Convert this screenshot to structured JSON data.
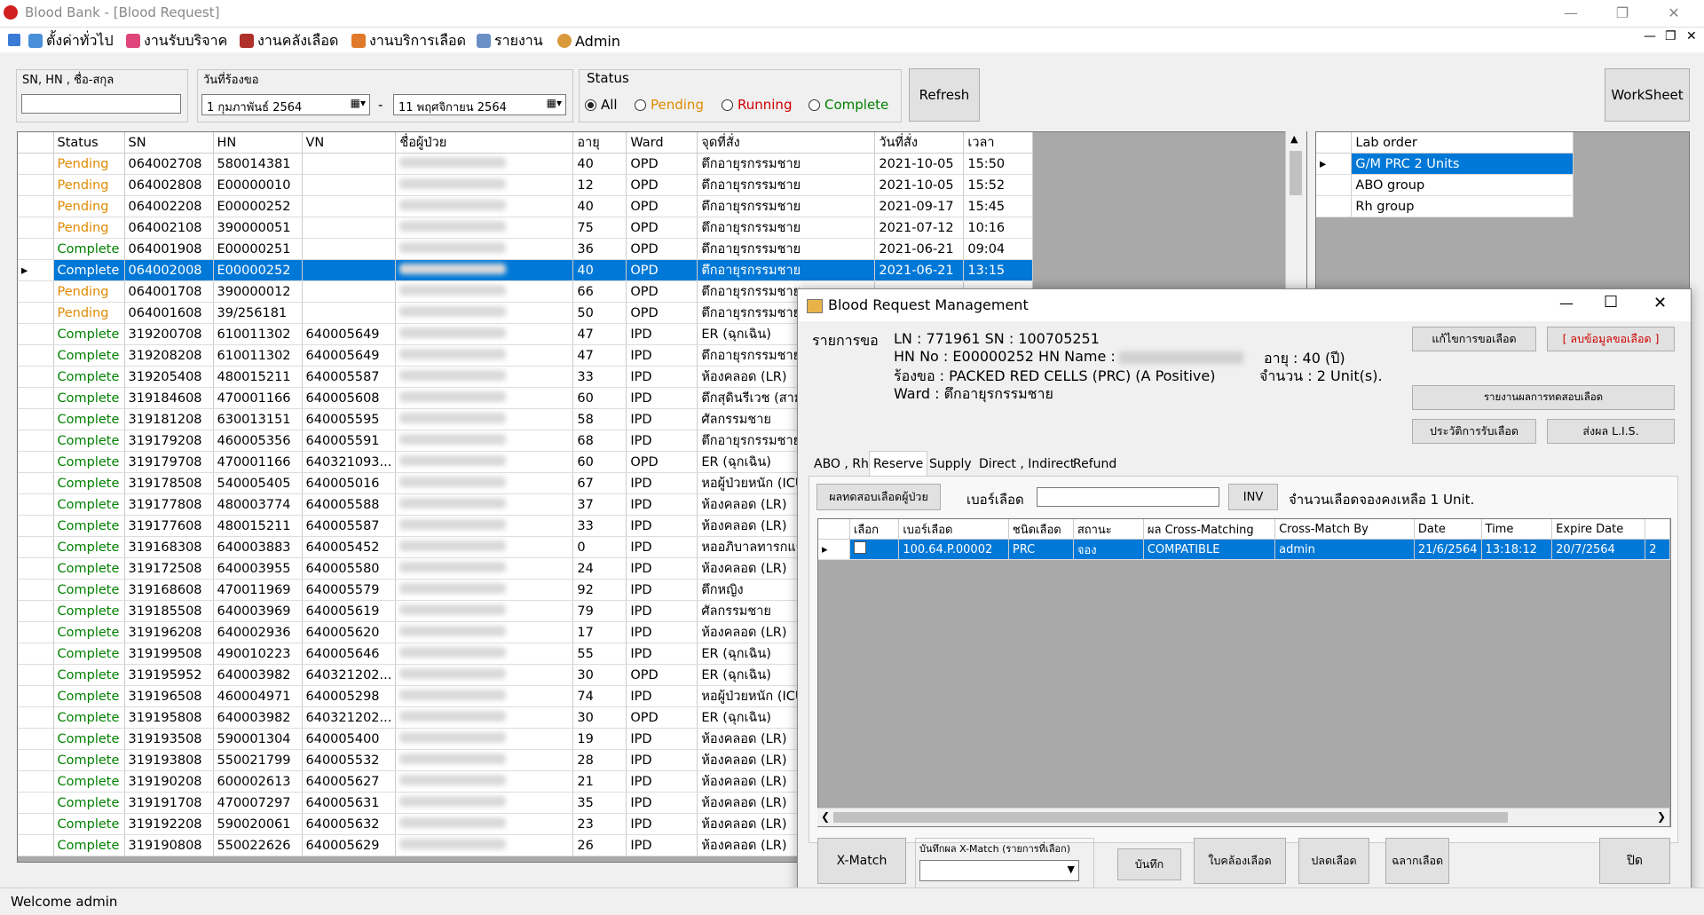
{
  "window": {
    "title": "Blood Bank - [Blood Request]"
  },
  "menu": [
    {
      "label": "ตั้งค่าทั่วไป",
      "icon": "settings-icon"
    },
    {
      "label": "งานรับบริจาค",
      "icon": "donate-icon"
    },
    {
      "label": "งานคลังเลือด",
      "icon": "blood-storage-icon"
    },
    {
      "label": "งานบริการเลือด",
      "icon": "blood-service-icon"
    },
    {
      "label": "รายงาน",
      "icon": "report-icon"
    },
    {
      "label": "Admin",
      "icon": "admin-icon"
    }
  ],
  "filters": {
    "search_label": "SN, HN , ชื่อ-สกุล",
    "search_value": "",
    "date_label": "วันที่ร้องขอ",
    "date_from": "1 กุมภาพันธ์   2564",
    "date_to": "11 พฤศจิกายน   2564",
    "date_sep": "-",
    "status_label": "Status",
    "status_options": [
      "All",
      "Pending",
      "Running",
      "Complete"
    ],
    "refresh": "Refresh",
    "worksheet": "WorkSheet",
    "colors": {
      "pending": "#e08a00",
      "running": "#d00000",
      "complete": "#008000"
    }
  },
  "grid": {
    "columns": [
      "Status",
      "SN",
      "HN",
      "VN",
      "ชื่อผู้ป่วย",
      "อายุ",
      "Ward",
      "จุดที่สั่ง",
      "วันที่สั่ง",
      "เวลา"
    ],
    "rows": [
      [
        "Pending",
        "064002708",
        "580014381",
        "",
        "",
        "40",
        "OPD",
        "ตึกอายุรกรรมชาย",
        "2021-10-05",
        "15:50"
      ],
      [
        "Pending",
        "064002808",
        "E00000010",
        "",
        "",
        "12",
        "OPD",
        "ตึกอายุรกรรมชาย",
        "2021-10-05",
        "15:52"
      ],
      [
        "Pending",
        "064002208",
        "E00000252",
        "",
        "",
        "40",
        "OPD",
        "ตึกอายุรกรรมชาย",
        "2021-09-17",
        "15:45"
      ],
      [
        "Pending",
        "064002108",
        "390000051",
        "",
        "",
        "75",
        "OPD",
        "ตึกอายุรกรรมชาย",
        "2021-07-12",
        "10:16"
      ],
      [
        "Complete",
        "064001908",
        "E00000251",
        "",
        "",
        "36",
        "OPD",
        "ตึกอายุรกรรมชาย",
        "2021-06-21",
        "09:04"
      ],
      [
        "Complete",
        "064002008",
        "E00000252",
        "",
        "",
        "40",
        "OPD",
        "ตึกอายุรกรรมชาย",
        "2021-06-21",
        "13:15"
      ],
      [
        "Pending",
        "064001708",
        "390000012",
        "",
        "",
        "66",
        "OPD",
        "ตึกอายุรกรรมชาย",
        "",
        ""
      ],
      [
        "Pending",
        "064001608",
        "39/256181",
        "",
        "",
        "50",
        "OPD",
        "ตึกอายุรกรรมชาย",
        "",
        ""
      ],
      [
        "Complete",
        "319200708",
        "610011302",
        "640005649",
        "",
        "47",
        "IPD",
        "ER (ฉุกเฉิน)",
        "",
        ""
      ],
      [
        "Complete",
        "319208208",
        "610011302",
        "640005649",
        "",
        "47",
        "IPD",
        "ตึกอายุรกรรมชาย",
        "",
        ""
      ],
      [
        "Complete",
        "319205408",
        "480015211",
        "640005587",
        "",
        "33",
        "IPD",
        "ห้องคลอด (LR)",
        "",
        ""
      ],
      [
        "Complete",
        "319184608",
        "470001166",
        "640005608",
        "",
        "60",
        "IPD",
        "ตึกสุดินรีเวช (สามัญ)",
        "",
        ""
      ],
      [
        "Complete",
        "319181208",
        "630013151",
        "640005595",
        "",
        "58",
        "IPD",
        "ศัลกรรมชาย",
        "",
        ""
      ],
      [
        "Complete",
        "319179208",
        "460005356",
        "640005591",
        "",
        "68",
        "IPD",
        "ตึกอายุรกรรมชาย",
        "",
        ""
      ],
      [
        "Complete",
        "319179708",
        "470001166",
        "640321093...",
        "",
        "60",
        "OPD",
        "ER (ฉุกเฉิน)",
        "",
        ""
      ],
      [
        "Complete",
        "319178508",
        "540005405",
        "640005016",
        "",
        "67",
        "IPD",
        "หอผู้ป่วยหนัก (ICU)",
        "",
        ""
      ],
      [
        "Complete",
        "319177808",
        "480003774",
        "640005588",
        "",
        "37",
        "IPD",
        "ห้องคลอด (LR)",
        "",
        ""
      ],
      [
        "Complete",
        "319177608",
        "480015211",
        "640005587",
        "",
        "33",
        "IPD",
        "ห้องคลอด (LR)",
        "",
        ""
      ],
      [
        "Complete",
        "319168308",
        "640003883",
        "640005452",
        "",
        "0",
        "IPD",
        "หออภิบาลทารกแรกเกิด",
        "",
        ""
      ],
      [
        "Complete",
        "319172508",
        "640003955",
        "640005580",
        "",
        "24",
        "IPD",
        "ห้องคลอด (LR)",
        "",
        ""
      ],
      [
        "Complete",
        "319168608",
        "470011969",
        "640005579",
        "",
        "92",
        "IPD",
        "ตึกหญิง",
        "",
        ""
      ],
      [
        "Complete",
        "319185508",
        "640003969",
        "640005619",
        "",
        "79",
        "IPD",
        "ศัลกรรมชาย",
        "",
        ""
      ],
      [
        "Complete",
        "319196208",
        "640002936",
        "640005620",
        "",
        "17",
        "IPD",
        "ห้องคลอด (LR)",
        "",
        ""
      ],
      [
        "Complete",
        "319199508",
        "490010223",
        "640005646",
        "",
        "55",
        "IPD",
        "ER (ฉุกเฉิน)",
        "",
        ""
      ],
      [
        "Complete",
        "319195952",
        "640003982",
        "640321202...",
        "",
        "30",
        "OPD",
        "ER (ฉุกเฉิน)",
        "",
        ""
      ],
      [
        "Complete",
        "319196508",
        "460004971",
        "640005298",
        "",
        "74",
        "IPD",
        "หอผู้ป่วยหนัก (ICU)",
        "",
        ""
      ],
      [
        "Complete",
        "319195808",
        "640003982",
        "640321202...",
        "",
        "30",
        "OPD",
        "ER (ฉุกเฉิน)",
        "",
        ""
      ],
      [
        "Complete",
        "319193508",
        "590001304",
        "640005400",
        "",
        "19",
        "IPD",
        "ห้องคลอด (LR)",
        "",
        ""
      ],
      [
        "Complete",
        "319193808",
        "550021799",
        "640005532",
        "",
        "28",
        "IPD",
        "ห้องคลอด (LR)",
        "",
        ""
      ],
      [
        "Complete",
        "319190208",
        "600002613",
        "640005627",
        "",
        "21",
        "IPD",
        "ห้องคลอด (LR)",
        "",
        ""
      ],
      [
        "Complete",
        "319191708",
        "470007297",
        "640005631",
        "",
        "35",
        "IPD",
        "ห้องคลอด (LR)",
        "",
        ""
      ],
      [
        "Complete",
        "319192208",
        "590020061",
        "640005632",
        "",
        "23",
        "IPD",
        "ห้องคลอด (LR)",
        "",
        ""
      ],
      [
        "Complete",
        "319190808",
        "550022626",
        "640005629",
        "",
        "26",
        "IPD",
        "ห้องคลอด (LR)",
        "",
        ""
      ]
    ]
  },
  "lab_order": {
    "header": "Lab order",
    "items": [
      "G/M PRC 2 Units",
      "ABO group",
      "Rh group"
    ]
  },
  "dialog": {
    "title": "Blood Request Management",
    "info_label": "รายการขอ",
    "line1": "LN : 771961    SN : 100705251",
    "hn": "HN No : E00000252    HN Name :",
    "age": "อายุ : 40 (ปี)",
    "request": "ร้องขอ : PACKED RED CELLS (PRC)     (A Positive)",
    "amount": "จำนวน : 2 Unit(s).",
    "ward": "Ward : ตึกอายุรกรรมชาย",
    "btn_edit": "แก้ไขการขอเลือด",
    "btn_delete": "[ ลบข้อมูลขอเลือด ]",
    "btn_report": "รายงานผลการทดสอบเลือด",
    "btn_history": "ประวัติการรับเลือด",
    "btn_lis": "ส่งผล L.I.S.",
    "tabs": [
      "ABO , Rh",
      "Reserve",
      "Supply",
      "Direct , Indirect",
      "Refund"
    ],
    "btn_patient_test": "ผลทดสอบเลือดผู้ป่วย",
    "blood_no_label": "เบอร์เลือด",
    "blood_no_value": "",
    "btn_inv": "INV",
    "remaining": "จำนวนเลือดจองคงเหลือ 1 Unit.",
    "res_columns": [
      "เลือก",
      "เบอร์เลือด",
      "ชนิดเลือด",
      "สถานะ",
      "ผล Cross-Matching",
      "Cross-Match By",
      "Date",
      "Time",
      "Expire Date"
    ],
    "res_rows": [
      [
        "",
        "100.64.P.00002",
        "PRC",
        "จอง",
        "COMPATIBLE",
        "admin",
        "21/6/2564",
        "13:18:12",
        "20/7/2564"
      ]
    ],
    "btn_xmatch": "X-Match",
    "xmatch_label": "บันทึกผล X-Match (รายการที่เลือก)",
    "xmatch_select": "",
    "btn_save": "บันทึก",
    "btn_release": "ใบคล้องเลือด",
    "btn_unreserve": "ปลดเลือด",
    "btn_label": "ฉลากเลือด",
    "btn_close": "ปิด"
  },
  "status_bar": {
    "text": "Welcome admin"
  }
}
